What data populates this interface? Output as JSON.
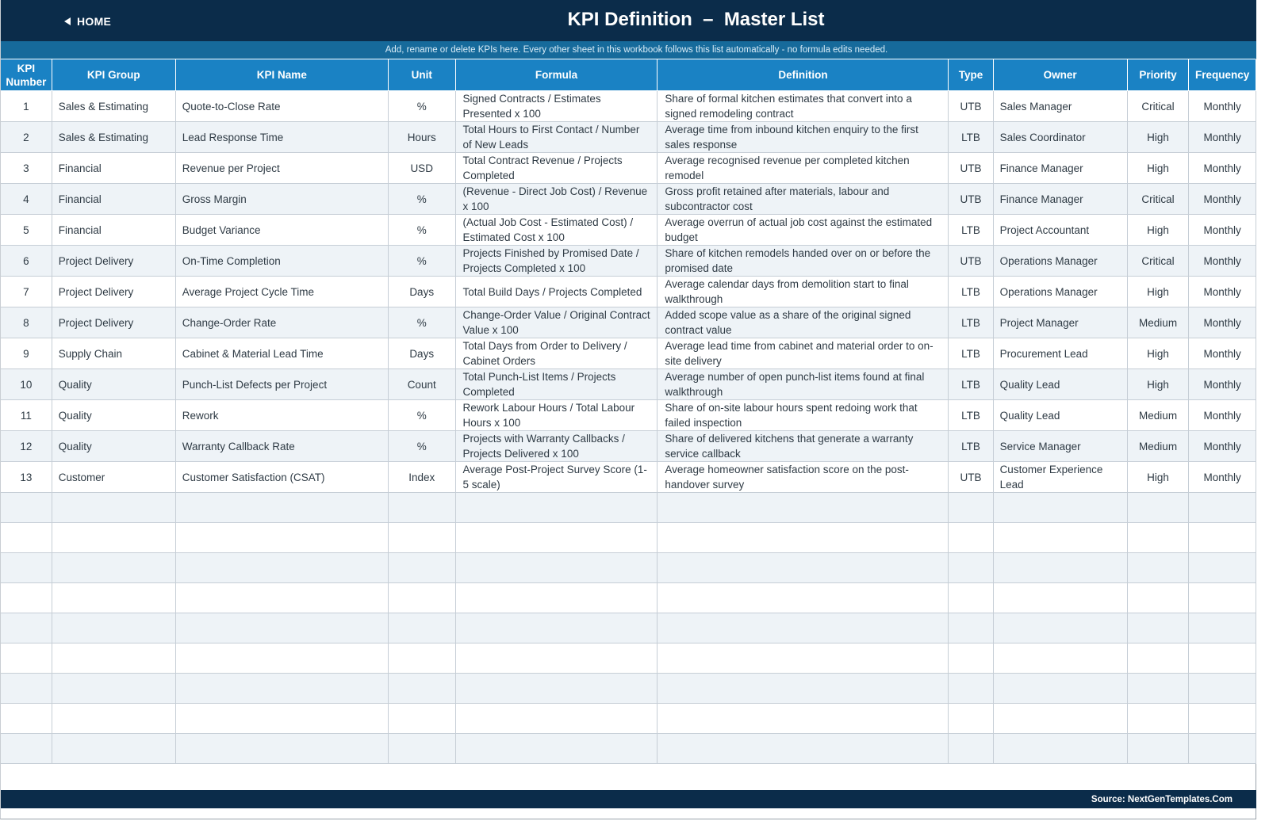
{
  "header": {
    "home_label": "HOME",
    "title": "KPI Definition  –  Master List",
    "subtitle": "Add, rename or delete KPIs here. Every other sheet in this workbook follows this list automatically - no formula edits needed."
  },
  "table": {
    "columns": [
      "KPI Number",
      "KPI Group",
      "KPI Name",
      "Unit",
      "Formula",
      "Definition",
      "Type",
      "Owner",
      "Priority",
      "Frequency"
    ],
    "rows": [
      [
        "1",
        "Sales & Estimating",
        "Quote-to-Close Rate",
        "%",
        "Signed Contracts / Estimates Presented x 100",
        "Share of formal kitchen estimates that convert into a signed remodeling contract",
        "UTB",
        "Sales Manager",
        "Critical",
        "Monthly"
      ],
      [
        "2",
        "Sales & Estimating",
        "Lead Response Time",
        "Hours",
        "Total Hours to First Contact / Number of New Leads",
        "Average time from inbound kitchen enquiry to the first sales response",
        "LTB",
        "Sales Coordinator",
        "High",
        "Monthly"
      ],
      [
        "3",
        "Financial",
        "Revenue per Project",
        "USD",
        "Total Contract Revenue / Projects Completed",
        "Average recognised revenue per completed kitchen remodel",
        "UTB",
        "Finance Manager",
        "High",
        "Monthly"
      ],
      [
        "4",
        "Financial",
        "Gross Margin",
        "%",
        "(Revenue - Direct Job Cost) / Revenue x 100",
        "Gross profit retained after materials, labour and subcontractor cost",
        "UTB",
        "Finance Manager",
        "Critical",
        "Monthly"
      ],
      [
        "5",
        "Financial",
        "Budget Variance",
        "%",
        "(Actual Job Cost - Estimated Cost) / Estimated Cost x 100",
        "Average overrun of actual job cost against the estimated budget",
        "LTB",
        "Project Accountant",
        "High",
        "Monthly"
      ],
      [
        "6",
        "Project Delivery",
        "On-Time Completion",
        "%",
        "Projects Finished by Promised Date / Projects Completed x 100",
        "Share of kitchen remodels handed over on or before the promised date",
        "UTB",
        "Operations Manager",
        "Critical",
        "Monthly"
      ],
      [
        "7",
        "Project Delivery",
        "Average Project Cycle Time",
        "Days",
        "Total Build Days / Projects Completed",
        "Average calendar days from demolition start to final walkthrough",
        "LTB",
        "Operations Manager",
        "High",
        "Monthly"
      ],
      [
        "8",
        "Project Delivery",
        "Change-Order Rate",
        "%",
        "Change-Order Value / Original Contract Value x 100",
        "Added scope value as a share of the original signed contract value",
        "LTB",
        "Project Manager",
        "Medium",
        "Monthly"
      ],
      [
        "9",
        "Supply Chain",
        "Cabinet & Material Lead Time",
        "Days",
        "Total Days from Order to Delivery / Cabinet Orders",
        "Average lead time from cabinet and material order to on-site delivery",
        "LTB",
        "Procurement Lead",
        "High",
        "Monthly"
      ],
      [
        "10",
        "Quality",
        "Punch-List Defects per Project",
        "Count",
        "Total Punch-List Items / Projects Completed",
        "Average number of open punch-list items found at final walkthrough",
        "LTB",
        "Quality Lead",
        "High",
        "Monthly"
      ],
      [
        "11",
        "Quality",
        "Rework",
        "%",
        "Rework Labour Hours / Total Labour Hours x 100",
        "Share of on-site labour hours spent redoing work that failed inspection",
        "LTB",
        "Quality Lead",
        "Medium",
        "Monthly"
      ],
      [
        "12",
        "Quality",
        "Warranty Callback Rate",
        "%",
        "Projects with Warranty Callbacks / Projects Delivered x 100",
        "Share of delivered kitchens that generate a warranty service callback",
        "LTB",
        "Service Manager",
        "Medium",
        "Monthly"
      ],
      [
        "13",
        "Customer",
        "Customer Satisfaction (CSAT)",
        "Index",
        "Average Post-Project Survey Score (1-5 scale)",
        "Average homeowner satisfaction score on the post-handover survey",
        "UTB",
        "Customer Experience Lead",
        "High",
        "Monthly"
      ]
    ],
    "empty_rows": 9
  },
  "footer": {
    "source": "Source: NextGenTemplates.Com"
  }
}
